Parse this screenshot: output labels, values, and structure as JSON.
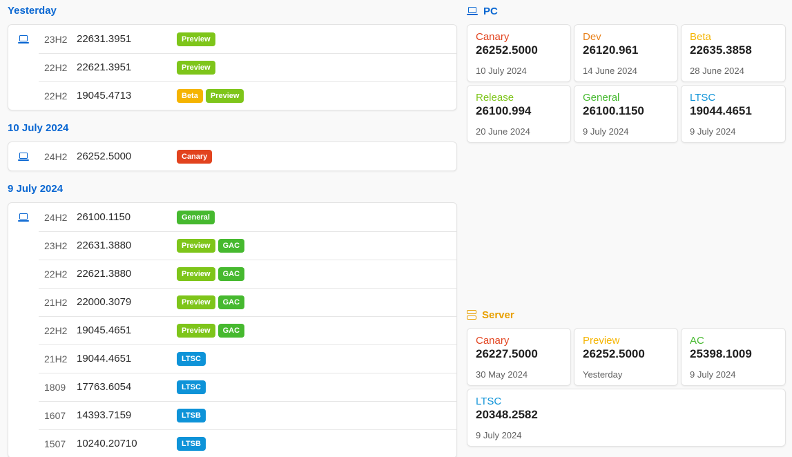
{
  "colors": {
    "link_blue": "#0a67d2",
    "canary": "#e2431e",
    "dev": "#e8811a",
    "beta": "#f5b400",
    "preview_green": "#7ec51a",
    "general": "#46b92f",
    "gac": "#46b92f",
    "ltsc": "#0e93d8",
    "server_accent": "#e8a000"
  },
  "groups": [
    {
      "title": "Yesterday",
      "rows": [
        {
          "ver": "23H2",
          "build": "22631.3951",
          "tags": [
            {
              "label": "Preview",
              "color": "#7ec51a"
            }
          ]
        },
        {
          "ver": "22H2",
          "build": "22621.3951",
          "tags": [
            {
              "label": "Preview",
              "color": "#7ec51a"
            }
          ]
        },
        {
          "ver": "22H2",
          "build": "19045.4713",
          "tags": [
            {
              "label": "Beta",
              "color": "#f5b400"
            },
            {
              "label": "Preview",
              "color": "#7ec51a"
            }
          ]
        }
      ]
    },
    {
      "title": "10 July 2024",
      "rows": [
        {
          "ver": "24H2",
          "build": "26252.5000",
          "tags": [
            {
              "label": "Canary",
              "color": "#e2431e"
            }
          ]
        }
      ]
    },
    {
      "title": "9 July 2024",
      "rows": [
        {
          "ver": "24H2",
          "build": "26100.1150",
          "tags": [
            {
              "label": "General",
              "color": "#46b92f"
            }
          ]
        },
        {
          "ver": "23H2",
          "build": "22631.3880",
          "tags": [
            {
              "label": "Preview",
              "color": "#7ec51a"
            },
            {
              "label": "GAC",
              "color": "#46b92f"
            }
          ]
        },
        {
          "ver": "22H2",
          "build": "22621.3880",
          "tags": [
            {
              "label": "Preview",
              "color": "#7ec51a"
            },
            {
              "label": "GAC",
              "color": "#46b92f"
            }
          ]
        },
        {
          "ver": "21H2",
          "build": "22000.3079",
          "tags": [
            {
              "label": "Preview",
              "color": "#7ec51a"
            },
            {
              "label": "GAC",
              "color": "#46b92f"
            }
          ]
        },
        {
          "ver": "22H2",
          "build": "19045.4651",
          "tags": [
            {
              "label": "Preview",
              "color": "#7ec51a"
            },
            {
              "label": "GAC",
              "color": "#46b92f"
            }
          ]
        },
        {
          "ver": "21H2",
          "build": "19044.4651",
          "tags": [
            {
              "label": "LTSC",
              "color": "#0e93d8"
            }
          ]
        },
        {
          "ver": "1809",
          "build": "17763.6054",
          "tags": [
            {
              "label": "LTSC",
              "color": "#0e93d8"
            }
          ]
        },
        {
          "ver": "1607",
          "build": "14393.7159",
          "tags": [
            {
              "label": "LTSB",
              "color": "#0e93d8"
            }
          ]
        },
        {
          "ver": "1507",
          "build": "10240.20710",
          "tags": [
            {
              "label": "LTSB",
              "color": "#0e93d8"
            }
          ]
        }
      ]
    }
  ],
  "pc": {
    "title": "PC",
    "tiles": [
      {
        "name": "Canary",
        "build": "26252.5000",
        "date": "10 July 2024",
        "color": "#e2431e"
      },
      {
        "name": "Dev",
        "build": "26120.961",
        "date": "14 June 2024",
        "color": "#e8811a"
      },
      {
        "name": "Beta",
        "build": "22635.3858",
        "date": "28 June 2024",
        "color": "#f5b400"
      },
      {
        "name": "Release",
        "build": "26100.994",
        "date": "20 June 2024",
        "color": "#7ec51a"
      },
      {
        "name": "General",
        "build": "26100.1150",
        "date": "9 July 2024",
        "color": "#46b92f"
      },
      {
        "name": "LTSC",
        "build": "19044.4651",
        "date": "9 July 2024",
        "color": "#0e93d8"
      }
    ]
  },
  "server": {
    "title": "Server",
    "tiles": [
      {
        "name": "Canary",
        "build": "26227.5000",
        "date": "30 May 2024",
        "color": "#e2431e"
      },
      {
        "name": "Preview",
        "build": "26252.5000",
        "date": "Yesterday",
        "color": "#f5b400"
      },
      {
        "name": "AC",
        "build": "25398.1009",
        "date": "9 July 2024",
        "color": "#46b92f"
      },
      {
        "name": "LTSC",
        "build": "20348.2582",
        "date": "9 July 2024",
        "color": "#0e93d8"
      }
    ]
  }
}
